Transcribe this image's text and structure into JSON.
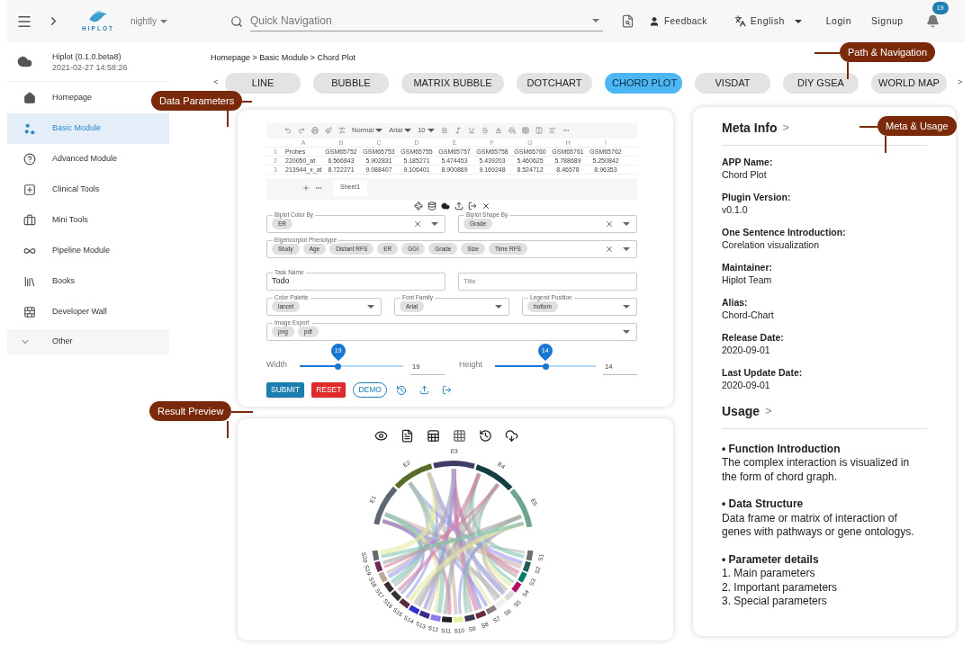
{
  "topbar": {
    "logo_text": "HIPLOT",
    "version": "nightly",
    "search": {
      "placeholder": "Quick Navigation"
    },
    "feedback": "Feedback",
    "language": "English",
    "login": "Login",
    "signup": "Signup",
    "notifications": "19"
  },
  "sidebar": {
    "app_name": "Hiplot (0.1.0.beta8)",
    "build_time": "2021-02-27 14:58:26",
    "items": [
      {
        "label": "Homepage",
        "selected": false
      },
      {
        "label": "Basic Module",
        "selected": true
      },
      {
        "label": "Advanced Module",
        "selected": false
      },
      {
        "label": "Clinical Tools",
        "selected": false
      },
      {
        "label": "Mini Tools",
        "selected": false
      },
      {
        "label": "Pipeline Module",
        "selected": false
      },
      {
        "label": "Books",
        "selected": false
      },
      {
        "label": "Developer Wall",
        "selected": false
      }
    ],
    "other": "Other"
  },
  "breadcrumb": "Homepage > Basic Module > Chord Plot",
  "tabs": {
    "prev": "<",
    "next": ">",
    "items": [
      {
        "label": "LINE",
        "selected": false
      },
      {
        "label": "BUBBLE",
        "selected": false
      },
      {
        "label": "MATRIX BUBBLE",
        "selected": false
      },
      {
        "label": "DOTCHART",
        "selected": false
      },
      {
        "label": "CHORD PLOT",
        "selected": true
      },
      {
        "label": "VISDAT",
        "selected": false
      },
      {
        "label": "DIY GSEA",
        "selected": false
      },
      {
        "label": "WORLD MAP",
        "selected": false
      }
    ]
  },
  "spreadsheet": {
    "toolbar": {
      "style": "Normal",
      "font": "Arial",
      "size": "10"
    },
    "columns": [
      "A",
      "B",
      "C",
      "D",
      "E",
      "F",
      "G",
      "H",
      "I"
    ],
    "rows": [
      {
        "number": "1",
        "cells": [
          "Probes",
          "GSM65752",
          "GSM65753",
          "GSM65755",
          "GSM65757",
          "GSM65758",
          "GSM65760",
          "GSM65761",
          "GSM65762"
        ]
      },
      {
        "number": "2",
        "cells": [
          "220050_at",
          "6.566843",
          "5.902831",
          "5.185271",
          "5.474453",
          "5.439203",
          "5.460625",
          "5.788689",
          "5.250842"
        ]
      },
      {
        "number": "3",
        "cells": [
          "213944_x_at",
          "8.722271",
          "9.088407",
          "9.106401",
          "8.900869",
          "9.169248",
          "8.524712",
          "8.46578",
          "8.96353"
        ]
      }
    ],
    "sheet_tab": "Sheet1"
  },
  "form": {
    "rows": [
      [
        {
          "kind": "multiselect",
          "label": "Biplot Color By",
          "chips": [
            "ER"
          ]
        },
        {
          "kind": "multiselect",
          "label": "Biplot Shape By",
          "chips": [
            "Grade"
          ]
        }
      ],
      [
        {
          "kind": "multiselect",
          "label": "Eigencorplot Phenotype",
          "chips": [
            "Study",
            "Age",
            "Distant RFS",
            "ER",
            "GGI",
            "Grade",
            "Size",
            "Time RFS"
          ]
        }
      ],
      [
        {
          "kind": "text",
          "label": "Task Name",
          "value": "Todo"
        },
        {
          "kind": "text",
          "placeholder": "Title"
        }
      ],
      [
        {
          "kind": "select",
          "label": "Color Palette",
          "chips": [
            "lancet"
          ]
        },
        {
          "kind": "select",
          "label": "Font Family",
          "chips": [
            "Arial"
          ]
        },
        {
          "kind": "select",
          "label": "Legend Position",
          "chips": [
            "bottom"
          ]
        }
      ],
      [
        {
          "kind": "select",
          "label": "Image Export",
          "chips": [
            "png",
            "pdf"
          ]
        }
      ]
    ]
  },
  "sliders": [
    {
      "label": "Width",
      "bubble": "19",
      "value": "19",
      "level": 0.37
    },
    {
      "label": "Height",
      "bubble": "14",
      "value": "14",
      "level": 0.5
    }
  ],
  "buttons": [
    {
      "label": "SUBMIT",
      "kind": "primary"
    },
    {
      "label": "RESET",
      "kind": "danger"
    },
    {
      "label": "DEMO",
      "kind": "outline"
    }
  ],
  "result": {
    "sectors": [
      "E1",
      "E2",
      "E3",
      "E4",
      "E5"
    ],
    "samples": [
      "S1",
      "S2",
      "S3",
      "S4",
      "S5",
      "S6",
      "S7",
      "S8",
      "S9",
      "S10",
      "S11",
      "S12",
      "S13",
      "S14",
      "S15",
      "S16",
      "S17",
      "S18",
      "S19",
      "S20"
    ]
  },
  "meta": {
    "title": "Meta Info",
    "arrow": ">",
    "fields": [
      {
        "label": "APP Name:",
        "value": "Chord Plot"
      },
      {
        "label": "Plugin Version:",
        "value": "v0.1.0"
      },
      {
        "label": "One Sentence Introduction:",
        "value": "Corelation visualization"
      },
      {
        "label": "Maintainer:",
        "value": "Hiplot Team"
      },
      {
        "label": "Alias:",
        "value": "Chord-Chart"
      },
      {
        "label": "Release Date:",
        "value": "2020-09-01"
      },
      {
        "label": "Last Update Date:",
        "value": "2020-09-01"
      }
    ]
  },
  "usage": {
    "title": "Usage",
    "arrow": ">",
    "sections": [
      {
        "heading": "• Function Introduction",
        "lines": [
          "The complex interaction is visualized in the form of chord graph."
        ]
      },
      {
        "heading": "• Data Structure",
        "lines": [
          "Data frame or matrix of interaction of genes with pathways or gene ontologys."
        ]
      },
      {
        "heading": "• Parameter details",
        "lines": [
          "1. Main parameters",
          "2. Important parameters",
          "3. Special parameters"
        ]
      }
    ]
  },
  "callouts": [
    {
      "label": "Data Parameters"
    },
    {
      "label": "Path & Navigation"
    },
    {
      "label": "Meta & Usage"
    },
    {
      "label": "Result Preview"
    }
  ]
}
